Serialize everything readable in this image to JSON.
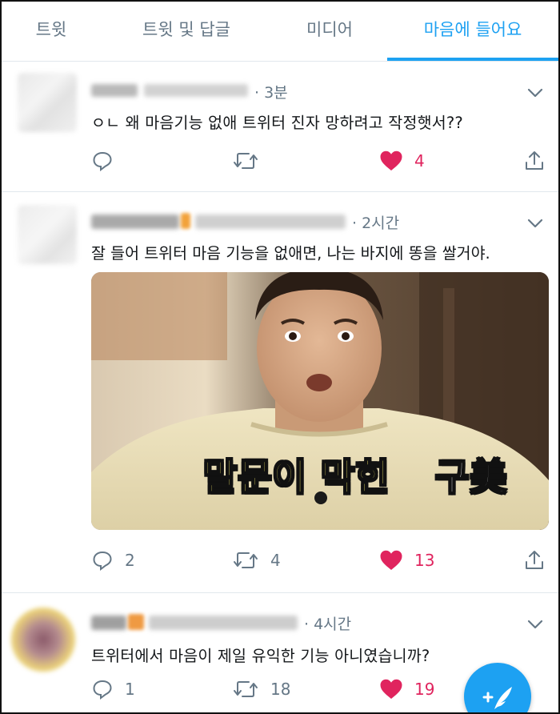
{
  "tabs": [
    {
      "label": "트윗"
    },
    {
      "label": "트윗 및 답글"
    },
    {
      "label": "미디어"
    },
    {
      "label": "마음에 들어요"
    }
  ],
  "colors": {
    "accent": "#1da1f2",
    "like": "#e0245e",
    "muted": "#657786"
  },
  "tweets": [
    {
      "time": "· 3분",
      "text": "ㅇㄴ 왜 마음기능 없애 트위터 진자 망하려고 작정햇서??",
      "reply_count": "",
      "retweet_count": "",
      "like_count": "4"
    },
    {
      "time": "· 2시간",
      "text": "잘 들어 트위터 마음 기능을 없애면, 나는 바지에 똥을 쌀거야.",
      "media_caption_1": "말문이 막힌",
      "media_caption_2": "구美",
      "reply_count": "2",
      "retweet_count": "4",
      "like_count": "13"
    },
    {
      "time": "· 4시간",
      "text": "트위터에서 마음이 제일 유익한 기능 아니였습니까?",
      "reply_count": "1",
      "retweet_count": "18",
      "like_count": "19"
    }
  ],
  "icons": [
    "reply-icon",
    "retweet-icon",
    "heart-icon",
    "share-icon",
    "caret-down-icon",
    "compose-icon"
  ]
}
